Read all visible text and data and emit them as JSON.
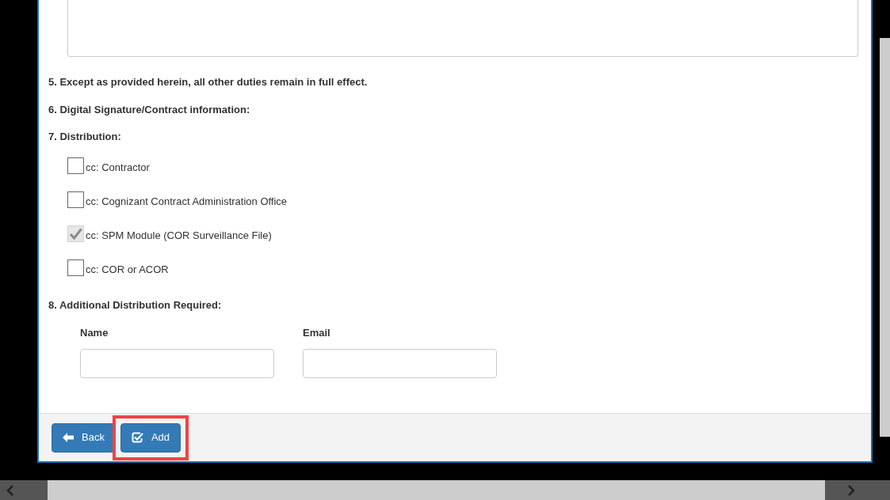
{
  "form": {
    "items": [
      {
        "text": "5. Except as provided herein, all other duties remain in full effect."
      },
      {
        "text": "6. Digital Signature/Contract information:"
      },
      {
        "text": "7. Distribution:"
      }
    ],
    "distribution": [
      {
        "label": "cc: Contractor",
        "checked": false,
        "disabled": false
      },
      {
        "label": "cc: Cognizant Contract Administration Office",
        "checked": false,
        "disabled": false
      },
      {
        "label": "cc: SPM Module (COR Surveillance File)",
        "checked": true,
        "disabled": true
      },
      {
        "label": "cc: COR or ACOR",
        "checked": false,
        "disabled": false
      }
    ],
    "additional_heading": "8. Additional Distribution Required:",
    "fields": [
      {
        "label": "Name"
      },
      {
        "label": "Email"
      }
    ]
  },
  "footer": {
    "buttons": [
      {
        "label": "Back",
        "kind": "back",
        "highlighted": false
      },
      {
        "label": "Add",
        "kind": "add",
        "highlighted": true
      }
    ]
  }
}
